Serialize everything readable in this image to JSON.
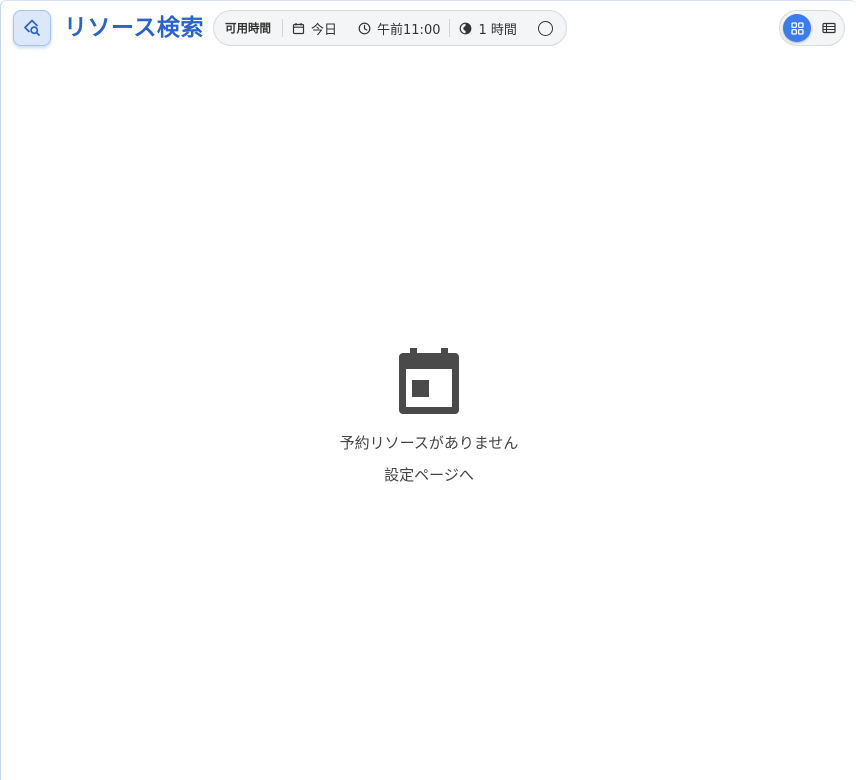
{
  "header": {
    "title": "リソース検索"
  },
  "filters": {
    "label": "可用時間",
    "date": "今日",
    "time": "午前11:00",
    "duration": "1 時間"
  },
  "empty_state": {
    "message": "予約リソースがありません",
    "settings_link": "設定ページへ"
  },
  "colors": {
    "accent": "#3b7cf0",
    "title": "#2a63c9",
    "icon_dark": "#4a4a4a"
  }
}
